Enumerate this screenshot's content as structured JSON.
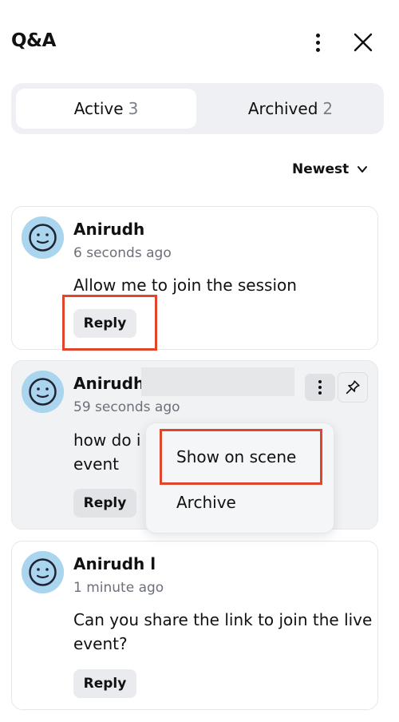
{
  "header": {
    "title": "Q&A"
  },
  "tabs": [
    {
      "label": "Active",
      "count": "3",
      "selected": true
    },
    {
      "label": "Archived",
      "count": "2",
      "selected": false
    }
  ],
  "sort": {
    "label": "Newest"
  },
  "questions": [
    {
      "author": "Anirudh",
      "time": "6 seconds ago",
      "text": "Allow me to join the session",
      "reply_label": "Reply"
    },
    {
      "author": "Anirudh",
      "time": "59 seconds ago",
      "text_line1": "how do i",
      "text_line2": "event",
      "reply_label": "Reply"
    },
    {
      "author": "Anirudh l",
      "time": "1 minute ago",
      "text": "Can you share the link to join the live event?",
      "reply_label": "Reply"
    }
  ],
  "menu": {
    "items": [
      "Show on scene",
      "Archive"
    ]
  },
  "colors": {
    "highlight": "#e1452b",
    "avatar": "#a9d5ee",
    "tabs_bg": "#eef0f3"
  }
}
